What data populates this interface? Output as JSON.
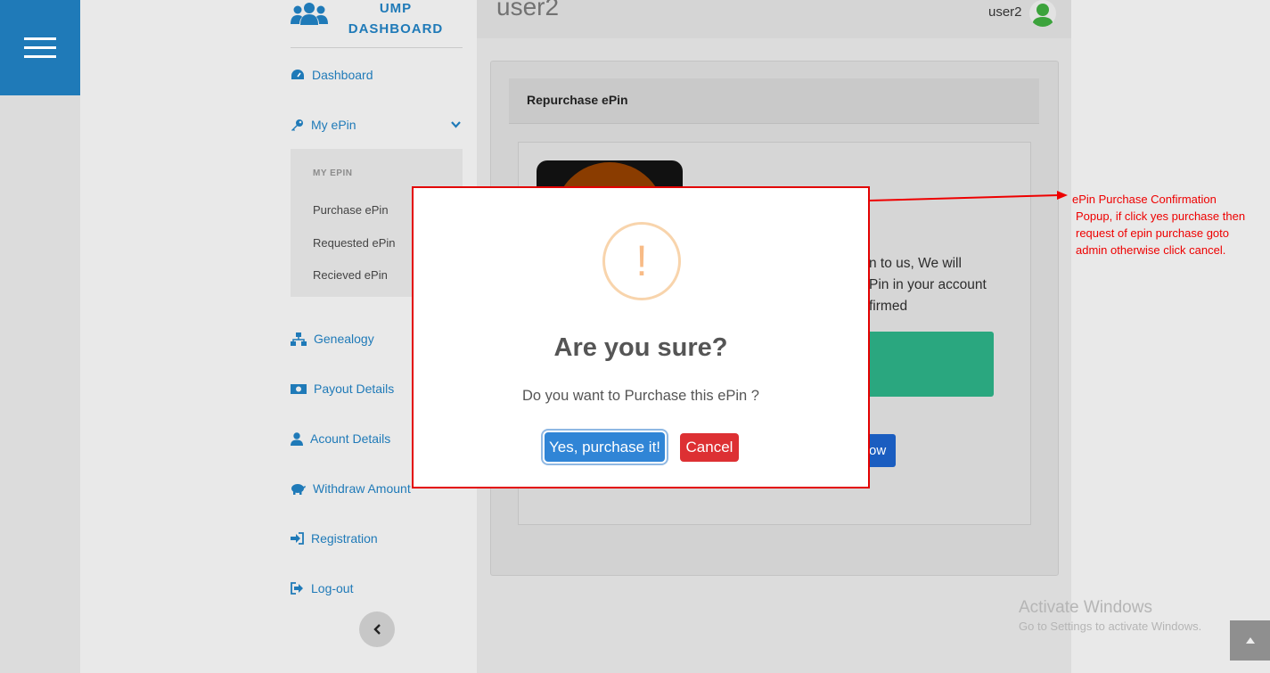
{
  "sidebar": {
    "logo_line1": "UMP",
    "logo_line2": "DASHBOARD",
    "items": {
      "dashboard": "Dashboard",
      "my_epin": "My ePin",
      "genealogy": "Genealogy",
      "payout": "Payout Details",
      "account": "Acount Details",
      "withdraw": "Withdraw Amount",
      "registration": "Registration",
      "logout": "Log-out"
    },
    "submenu": {
      "header": "MY EPIN",
      "purchase": "Purchase ePin",
      "requested": "Requested ePin",
      "received": "Recieved ePin"
    }
  },
  "header": {
    "title": "user2",
    "username": "user2"
  },
  "card": {
    "title": "Repurchase ePin",
    "text_line1": "n to us, We will",
    "text_line2": "Pin in your account",
    "text_line3": "firmed",
    "button_partial": "ow"
  },
  "modal": {
    "icon": "!",
    "title": "Are you sure?",
    "text": "Do you want to Purchase this ePin ?",
    "confirm": "Yes, purchase it!",
    "cancel": "Cancel"
  },
  "annotation": {
    "line1": "ePin Purchase Confirmation",
    "line2": "Popup, if click yes purchase then",
    "line3": "request of epin purchase goto",
    "line4": "admin otherwise click cancel."
  },
  "watermark": {
    "title": "Activate Windows",
    "subtitle": "Go to Settings to activate Windows."
  },
  "colors": {
    "brand": "#1f7ab8",
    "confirm": "#3085d6",
    "cancel": "#dd3033",
    "annotation": "#ee0000",
    "warning": "#f8bb86"
  }
}
